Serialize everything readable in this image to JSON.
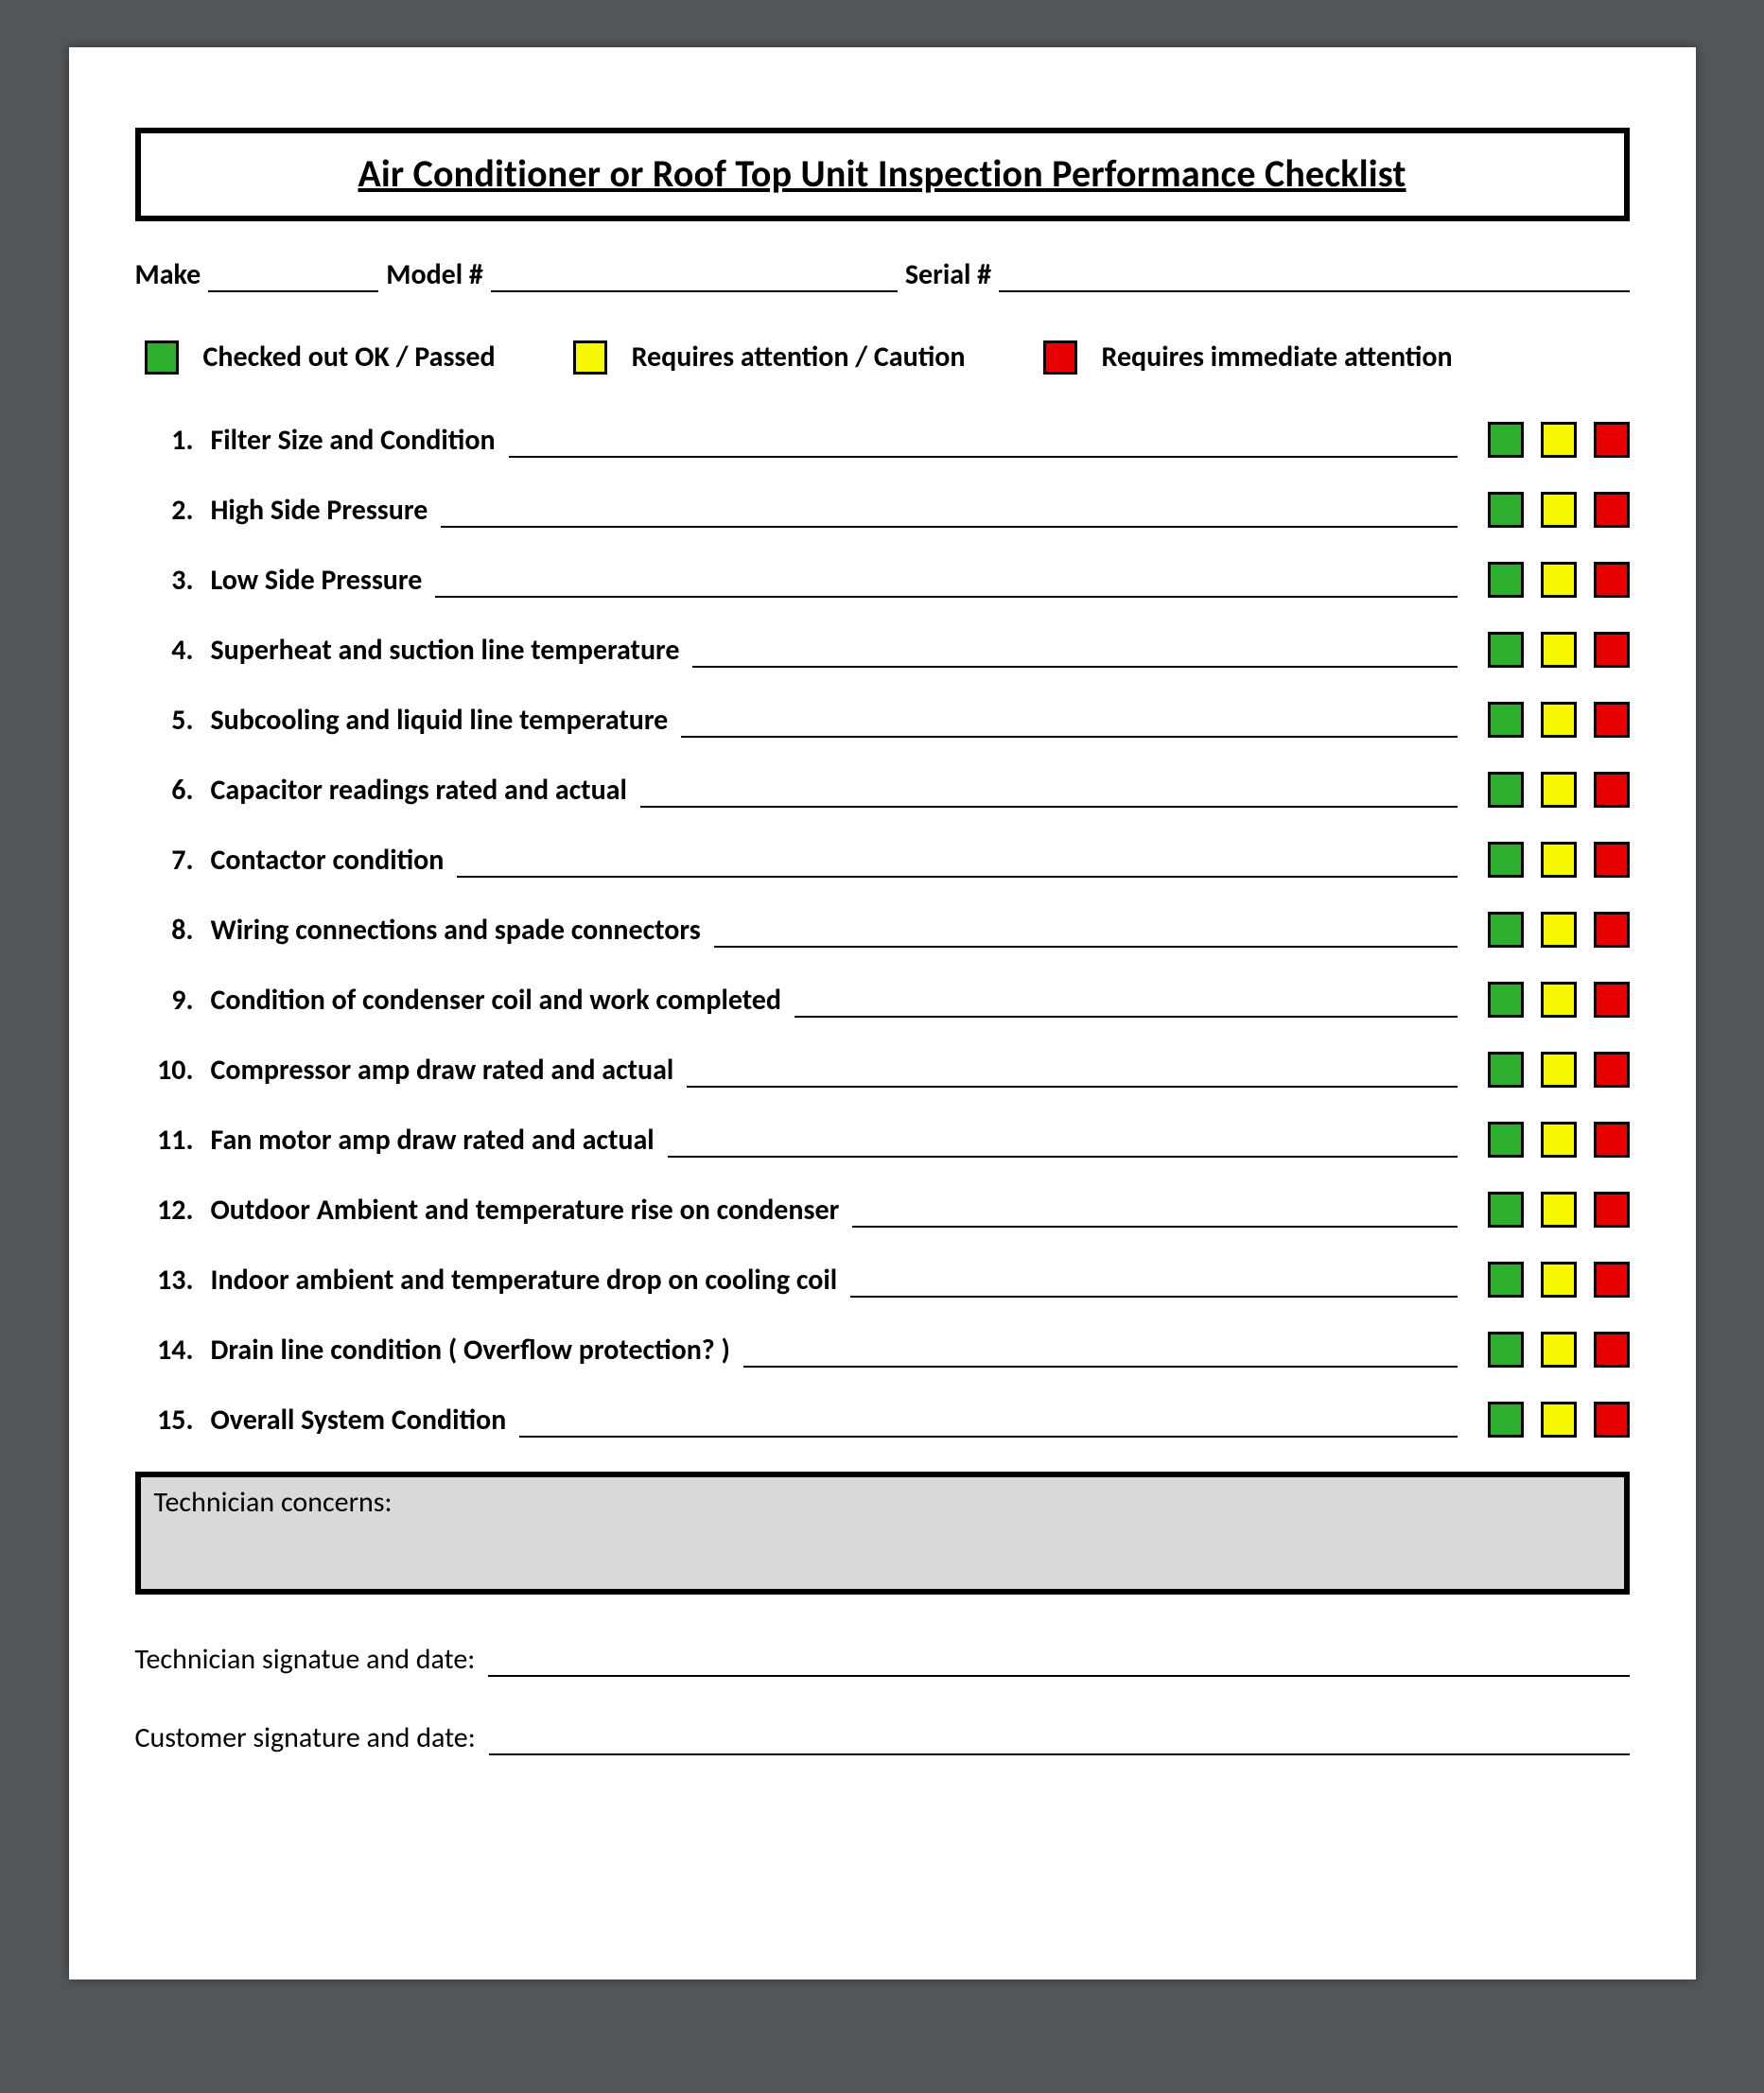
{
  "title": "Air Conditioner or Roof Top Unit Inspection Performance Checklist",
  "header": {
    "make_label": "Make",
    "model_label": "Model #",
    "serial_label": "Serial #"
  },
  "legend": {
    "ok": "Checked out OK / Passed",
    "caution": "Requires attention / Caution",
    "immediate": "Requires immediate attention"
  },
  "items": [
    {
      "num": "1.",
      "label": "Filter Size and Condition"
    },
    {
      "num": "2.",
      "label": "High Side Pressure"
    },
    {
      "num": "3.",
      "label": "Low Side Pressure"
    },
    {
      "num": "4.",
      "label": "Superheat and suction line temperature"
    },
    {
      "num": "5.",
      "label": "Subcooling and liquid line temperature"
    },
    {
      "num": "6.",
      "label": "Capacitor readings rated and actual"
    },
    {
      "num": "7.",
      "label": "Contactor condition"
    },
    {
      "num": "8.",
      "label": "Wiring connections and spade connectors"
    },
    {
      "num": "9.",
      "label": "Condition of condenser coil and work completed"
    },
    {
      "num": "10.",
      "label": "Compressor amp draw rated and actual"
    },
    {
      "num": "11.",
      "label": "Fan motor amp draw rated and actual"
    },
    {
      "num": "12.",
      "label": "Outdoor Ambient and temperature rise on condenser"
    },
    {
      "num": "13.",
      "label": "Indoor ambient and temperature drop on cooling coil"
    },
    {
      "num": "14.",
      "label": "Drain line condition ( Overflow protection? )"
    },
    {
      "num": "15.",
      "label": "Overall System Condition"
    }
  ],
  "concerns_label": "Technician concerns:",
  "signatures": {
    "tech": "Technician signatue and date:",
    "customer": "Customer signature and date:"
  },
  "colors": {
    "green": "#2eae2e",
    "yellow": "#f7f700",
    "red": "#e60000"
  }
}
